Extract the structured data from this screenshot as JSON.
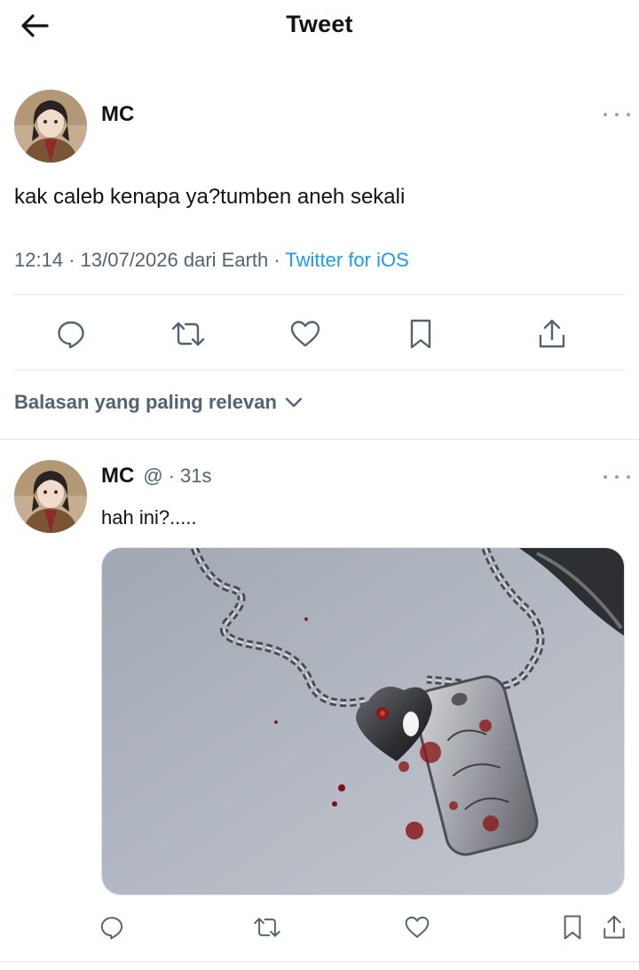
{
  "topbar": {
    "title": "Tweet",
    "back_icon": "arrow-left-icon"
  },
  "tweet": {
    "author": "MC",
    "text": "kak caleb kenapa ya?tumben aneh sekali",
    "time": "12:14",
    "sep1": "·",
    "date_location": "13/07/2026 dari Earth",
    "sep2": "·",
    "source": "Twitter for iOS"
  },
  "actions": {
    "icons": [
      "reply-icon",
      "retweet-icon",
      "like-icon",
      "bookmark-icon",
      "share-icon"
    ]
  },
  "replies_sort": {
    "label": "Balasan yang paling relevan",
    "icon": "chevron-down-icon"
  },
  "reply": {
    "author": "MC",
    "handle": "@",
    "sep": "·",
    "time": "31s",
    "text": "hah ini?.....",
    "media": "photo"
  },
  "colors": {
    "text": "#0f1419",
    "secondary": "#536471",
    "link": "#1d9bf0",
    "divider": "#e1e6ea"
  }
}
